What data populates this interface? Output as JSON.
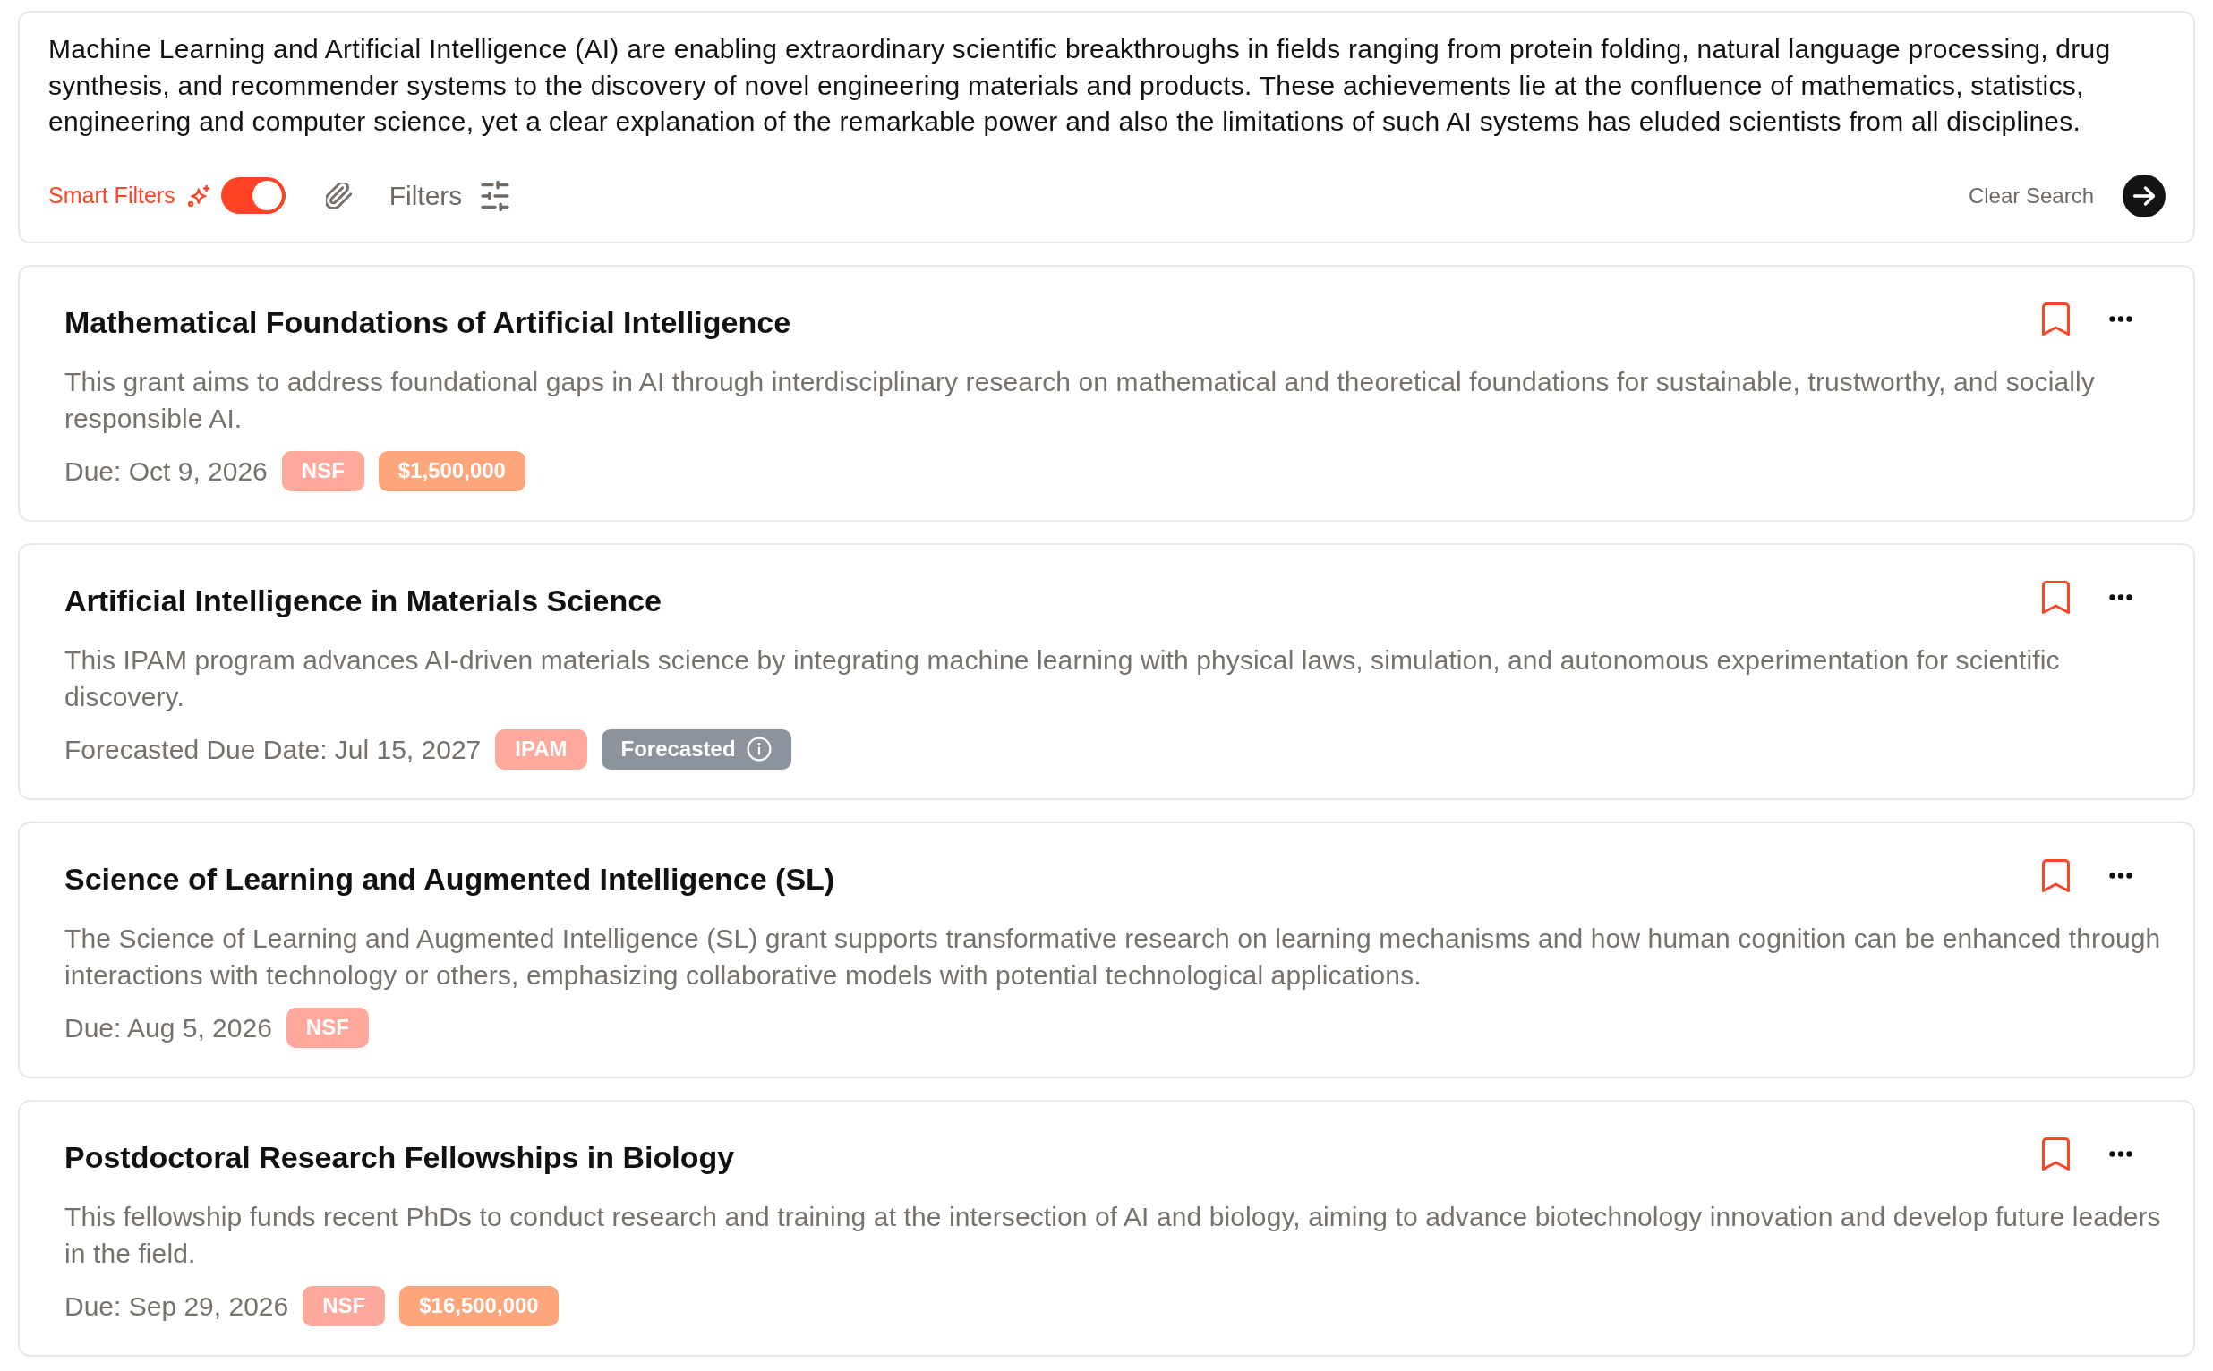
{
  "search": {
    "query": "Machine Learning and Artificial Intelligence (AI) are enabling extraordinary scientific breakthroughs in fields ranging from protein folding, natural language processing, drug synthesis, and recommender systems to the discovery of novel engineering materials and products. These achievements lie at the confluence of mathematics, statistics, engineering and computer science, yet a clear explanation of the remarkable power and also the limitations of such AI systems has eluded scientists from all disciplines.",
    "smart_filters": {
      "label": "Smart Filters",
      "on": true
    },
    "filters": {
      "label": "Filters"
    },
    "clear": {
      "label": "Clear Search"
    }
  },
  "results": [
    {
      "title": "Mathematical Foundations of Artificial Intelligence",
      "description": "This grant aims to address foundational gaps in AI through interdisciplinary research on mathematical and theoretical foundations for sustainable, trustworthy, and socially responsible AI.",
      "due": "Due: Oct 9, 2026",
      "tags": [
        {
          "kind": "agency",
          "label": "NSF"
        },
        {
          "kind": "amount",
          "label": "$1,500,000"
        }
      ]
    },
    {
      "title": "Artificial Intelligence in Materials Science",
      "description": "This IPAM program advances AI-driven materials science by integrating machine learning with physical laws, simulation, and autonomous experimentation for scientific discovery.",
      "due": "Forecasted Due Date: Jul 15, 2027",
      "tags": [
        {
          "kind": "agency",
          "label": "IPAM"
        },
        {
          "kind": "status",
          "label": "Forecasted"
        }
      ]
    },
    {
      "title": "Science of Learning and Augmented Intelligence (SL)",
      "description": "The Science of Learning and Augmented Intelligence (SL) grant supports transformative research on learning mechanisms and how human cognition can be enhanced through interactions with technology or others, emphasizing collaborative models with potential technological applications.",
      "due": "Due: Aug 5, 2026",
      "tags": [
        {
          "kind": "agency",
          "label": "NSF"
        }
      ]
    },
    {
      "title": "Postdoctoral Research Fellowships in Biology",
      "description": "This fellowship funds recent PhDs to conduct research and training at the intersection of AI and biology, aiming to advance biotechnology innovation and develop future leaders in the field.",
      "due": "Due: Sep 29, 2026",
      "tags": [
        {
          "kind": "agency",
          "label": "NSF"
        },
        {
          "kind": "amount",
          "label": "$16,500,000"
        }
      ]
    }
  ]
}
